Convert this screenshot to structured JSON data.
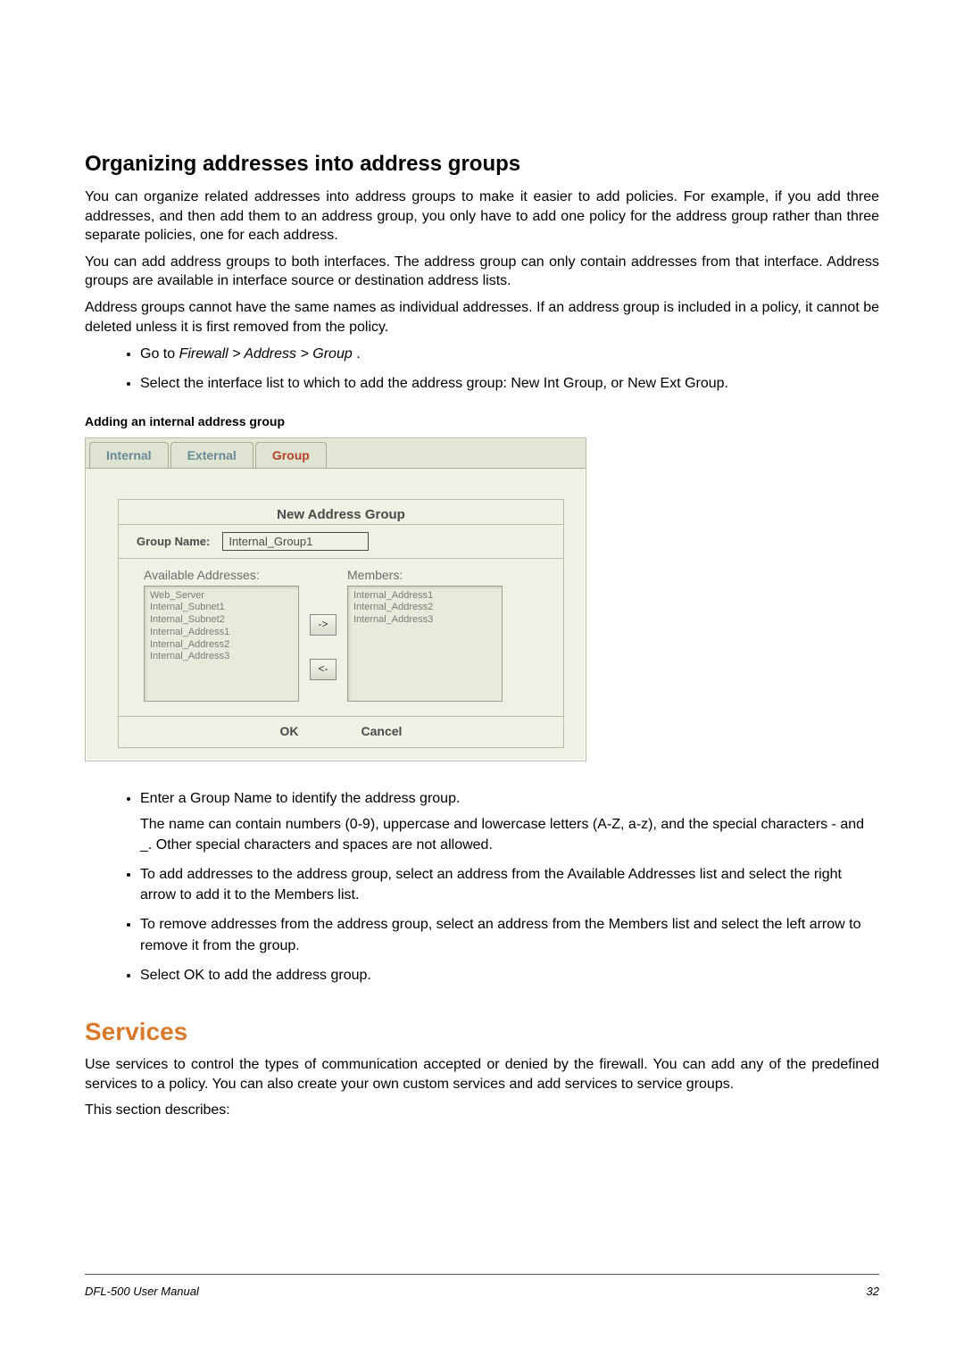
{
  "headings": {
    "organizing": "Organizing addresses into address groups",
    "services": "Services"
  },
  "paragraphs": {
    "p1": "You can organize related addresses into address groups to make it easier to add policies. For example, if you add three addresses, and then add them to an address group, you only have to add one policy for the address group rather than three separate policies, one for each address.",
    "p2": "You can add address groups to both interfaces. The address group can only contain addresses from that interface. Address groups are available in interface source or destination address lists.",
    "p3": "Address groups cannot have the same names as individual addresses. If an address group is included in a policy, it cannot be deleted unless it is first removed from the policy.",
    "li1a": "Go to ",
    "li1b": "Firewall > Address > Group ",
    "li1c": ".",
    "li2": "Select the interface list to which to add the address group: New Int Group, or New Ext Group.",
    "caption": "Adding an internal address group",
    "li3": "Enter a Group Name to identify the address group.",
    "li3sub": "The name can contain numbers (0-9), uppercase and lowercase letters (A-Z, a-z), and the special characters - and _. Other special characters and spaces are not allowed.",
    "li4": "To add addresses to the address group, select an address from the Available Addresses list and select the right arrow to add it to the Members list.",
    "li5": "To remove addresses from the address group, select an address from the Members list and select the left arrow to remove it from the group.",
    "li6": "Select OK to add the address group.",
    "services_p1": "Use services to control the types of communication accepted or denied by the firewall. You can add any of the predefined services to a policy. You can also create your own custom services and add services to service groups.",
    "services_p2": "This section describes:"
  },
  "screenshot": {
    "tabs": {
      "internal": "Internal",
      "external": "External",
      "group": "Group"
    },
    "panel_title": "New Address Group",
    "group_name_label": "Group Name:",
    "group_name_value": "Internal_Group1",
    "available_label": "Available Addresses:",
    "members_label": "Members:",
    "available_list": "Web_Server\nInternal_Subnet1\nInternal_Subnet2\nInternal_Address1\nInternal_Address2\nInternal_Address3",
    "members_list": "Internal_Address1\nInternal_Address2\nInternal_Address3",
    "btn_right": "->",
    "btn_left": "<-",
    "btn_ok": "OK",
    "btn_cancel": "Cancel"
  },
  "footer": {
    "left": "DFL-500 User Manual",
    "right": "32"
  }
}
